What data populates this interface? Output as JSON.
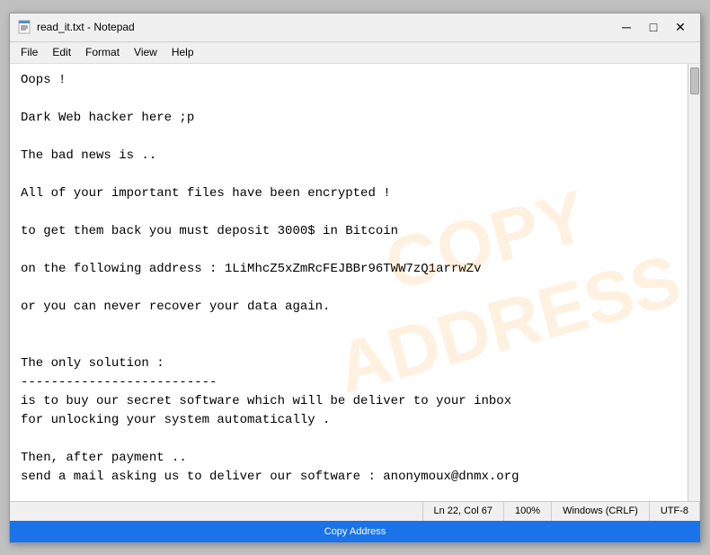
{
  "titleBar": {
    "icon": "notepad",
    "title": "read_it.txt - Notepad",
    "minimizeLabel": "─",
    "maximizeLabel": "□",
    "closeLabel": "✕"
  },
  "menuBar": {
    "items": [
      "File",
      "Edit",
      "Format",
      "View",
      "Help"
    ]
  },
  "textContent": "Oops !\n\nDark Web hacker here ;p\n\nThe bad news is ..\n\nAll of your important files have been encrypted !\n\nto get them back you must deposit 3000$ in Bitcoin\n\non the following address : 1LiMhcZ5xZmRcFEJBBr96TWW7zQ1arrwZv\n\nor you can never recover your data again.\n\n\nThe only solution :\n--------------------------\nis to buy our secret software which will be deliver to your inbox\nfor unlocking your system automatically .\n\nThen, after payment ..\nsend a mail asking us to deliver our software : anonymoux@dnmx.org",
  "watermark": {
    "line1": "COPY",
    "line2": "ADDRESS"
  },
  "statusBar": {
    "ln": "Ln 22, Col 67",
    "zoom": "100%",
    "lineEnding": "Windows (CRLF)",
    "encoding": "UTF-8"
  },
  "copyAddressBar": {
    "label": "Copy Address"
  }
}
